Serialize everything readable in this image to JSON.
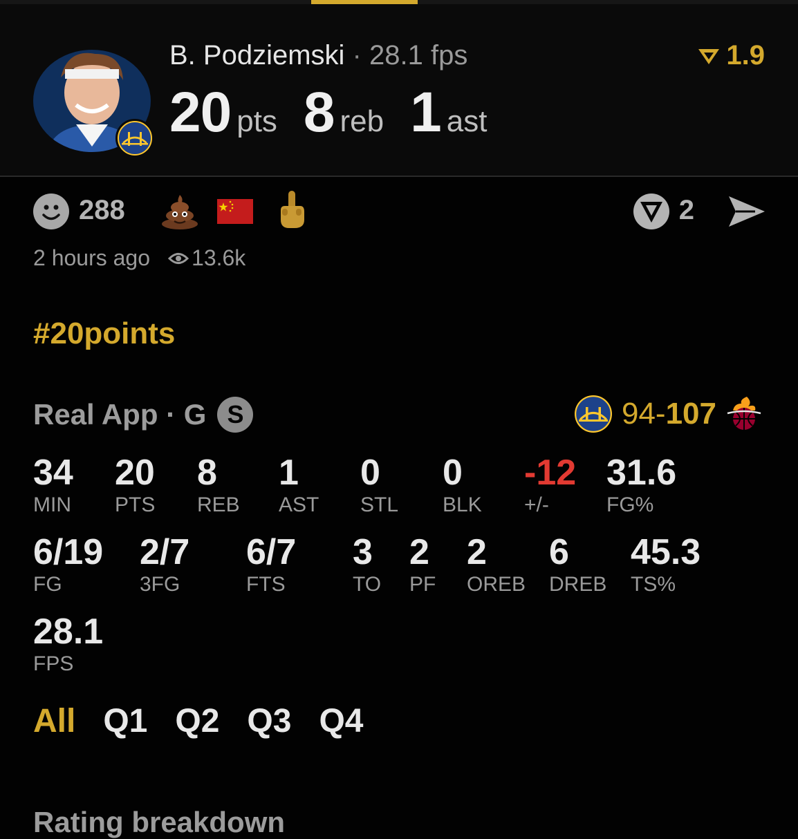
{
  "player": {
    "name": "B. Podziemski",
    "separator": "·",
    "fps_text": "28.1 fps",
    "rating": "1.9",
    "headline": [
      {
        "value": "20",
        "unit": "pts"
      },
      {
        "value": "8",
        "unit": "reb"
      },
      {
        "value": "1",
        "unit": "ast"
      }
    ]
  },
  "reactions": {
    "smile_count": "288",
    "comment_count": "2"
  },
  "meta": {
    "posted": "2 hours ago",
    "views": "13.6k"
  },
  "hashtag": "#20points",
  "game": {
    "source": "Real App · G",
    "badge": "S",
    "home_score": "94",
    "dash": "-",
    "away_score": "107"
  },
  "stats": {
    "row1": [
      {
        "value": "34",
        "label": "MIN"
      },
      {
        "value": "20",
        "label": "PTS"
      },
      {
        "value": "8",
        "label": "REB"
      },
      {
        "value": "1",
        "label": "AST"
      },
      {
        "value": "0",
        "label": "STL"
      },
      {
        "value": "0",
        "label": "BLK"
      },
      {
        "value": "-12",
        "label": "+/-"
      },
      {
        "value": "31.6",
        "label": "FG%"
      }
    ],
    "row2": [
      {
        "value": "6/19",
        "label": "FG"
      },
      {
        "value": "2/7",
        "label": "3FG"
      },
      {
        "value": "6/7",
        "label": "FTS"
      },
      {
        "value": "3",
        "label": "TO"
      },
      {
        "value": "2",
        "label": "PF"
      },
      {
        "value": "2",
        "label": "OREB"
      },
      {
        "value": "6",
        "label": "DREB"
      },
      {
        "value": "45.3",
        "label": "TS%"
      }
    ],
    "row3": [
      {
        "value": "28.1",
        "label": "FPS"
      }
    ]
  },
  "quarters": [
    "All",
    "Q1",
    "Q2",
    "Q3",
    "Q4"
  ],
  "section_title": "Rating breakdown",
  "colors": {
    "accent": "#d4a92d",
    "negative": "#e23a32",
    "background": "#020202"
  },
  "icons": [
    "smiley-icon",
    "poop-emoji-icon",
    "china-flag-icon",
    "middle-finger-emoji-icon",
    "comment-icon",
    "share-icon",
    "eye-icon",
    "rating-v-icon",
    "warriors-logo-icon",
    "heat-logo-icon"
  ]
}
